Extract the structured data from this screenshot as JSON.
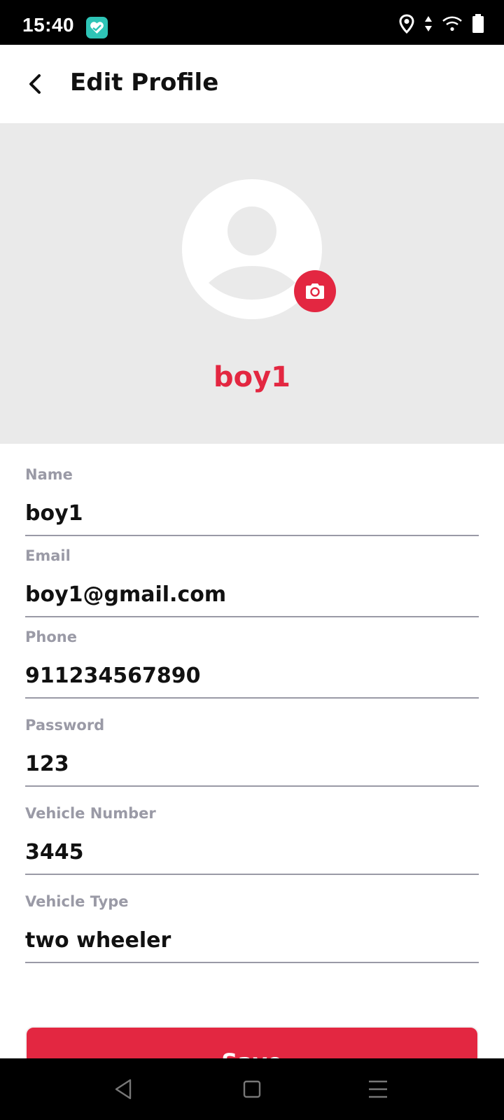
{
  "status_bar": {
    "time": "15:40",
    "icons": [
      "app-heart-icon",
      "location-icon",
      "data-arrows-icon",
      "wifi-icon",
      "battery-icon"
    ]
  },
  "header": {
    "title": "Edit Profile",
    "back_icon": "chevron-left-icon"
  },
  "profile": {
    "name": "boy1",
    "avatar_icon": "user-placeholder-icon",
    "camera_icon": "camera-icon"
  },
  "form": {
    "fields": [
      {
        "label": "Name",
        "value": "boy1"
      },
      {
        "label": "Email",
        "value": "boy1@gmail.com"
      },
      {
        "label": "Phone",
        "value": "911234567890"
      },
      {
        "label": "Password",
        "value": "123"
      },
      {
        "label": "Vehicle Number",
        "value": "3445"
      },
      {
        "label": "Vehicle Type",
        "value": "two wheeler"
      }
    ]
  },
  "save": {
    "label": "Save"
  },
  "nav": {
    "icons": [
      "back-triangle-icon",
      "home-square-icon",
      "menu-lines-icon"
    ]
  },
  "colors": {
    "accent": "#e32741",
    "panel": "#eaeaea",
    "label": "#9a9aa6"
  }
}
